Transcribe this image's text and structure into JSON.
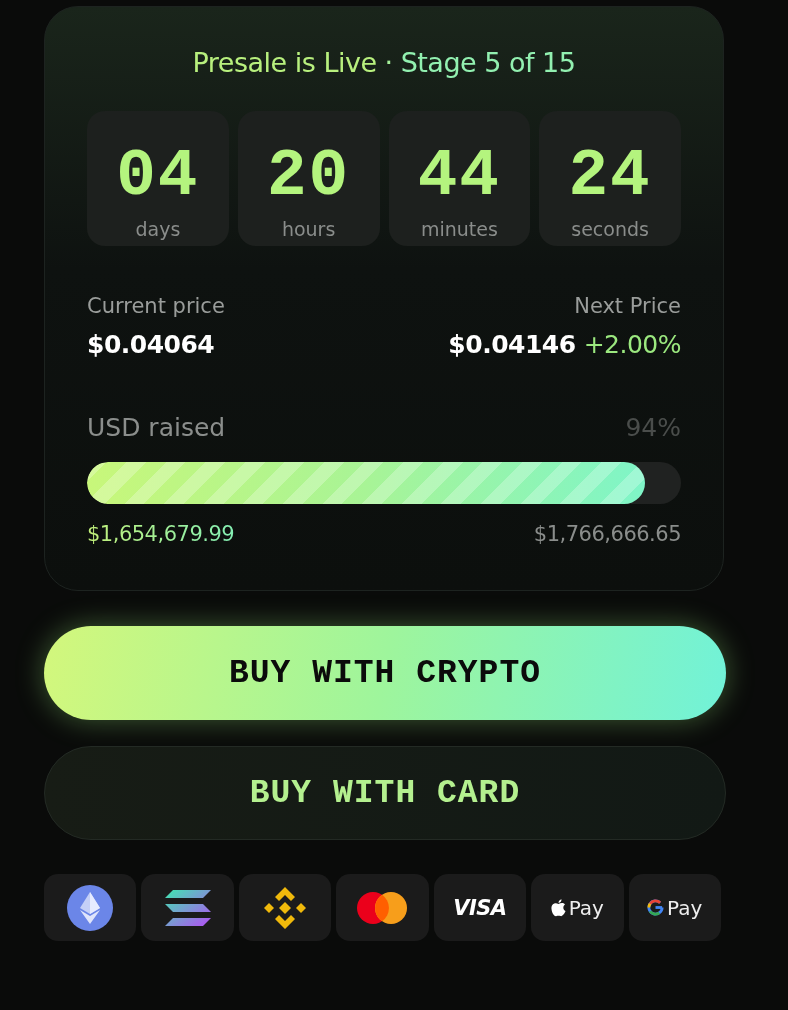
{
  "header": {
    "status": "Presale is Live",
    "separator": "·",
    "stage": "Stage 5 of 15"
  },
  "countdown": [
    {
      "value": "04",
      "unit": "days"
    },
    {
      "value": "20",
      "unit": "hours"
    },
    {
      "value": "44",
      "unit": "minutes"
    },
    {
      "value": "24",
      "unit": "seconds"
    }
  ],
  "prices": {
    "current_label": "Current price",
    "current_value": "$0.04064",
    "next_label": "Next Price",
    "next_value": "$0.04146",
    "next_change": "+2.00%"
  },
  "raised": {
    "label": "USD raised",
    "percent": "94%",
    "level": 0.94,
    "amount": "$1,654,679.99",
    "target": "$1,766,666.65"
  },
  "buttons": [
    {
      "label": "BUY WITH CRYPTO",
      "kind": "primary"
    },
    {
      "label": "BUY WITH CARD",
      "kind": "secondary"
    }
  ],
  "payment_methods": [
    {
      "kind": "eth"
    },
    {
      "kind": "sol"
    },
    {
      "kind": "bnb"
    },
    {
      "kind": "mastercard"
    },
    {
      "kind": "visa",
      "label": "VISA"
    },
    {
      "kind": "applepay",
      "label": "Pay"
    },
    {
      "kind": "gpay",
      "label": "Pay"
    }
  ]
}
